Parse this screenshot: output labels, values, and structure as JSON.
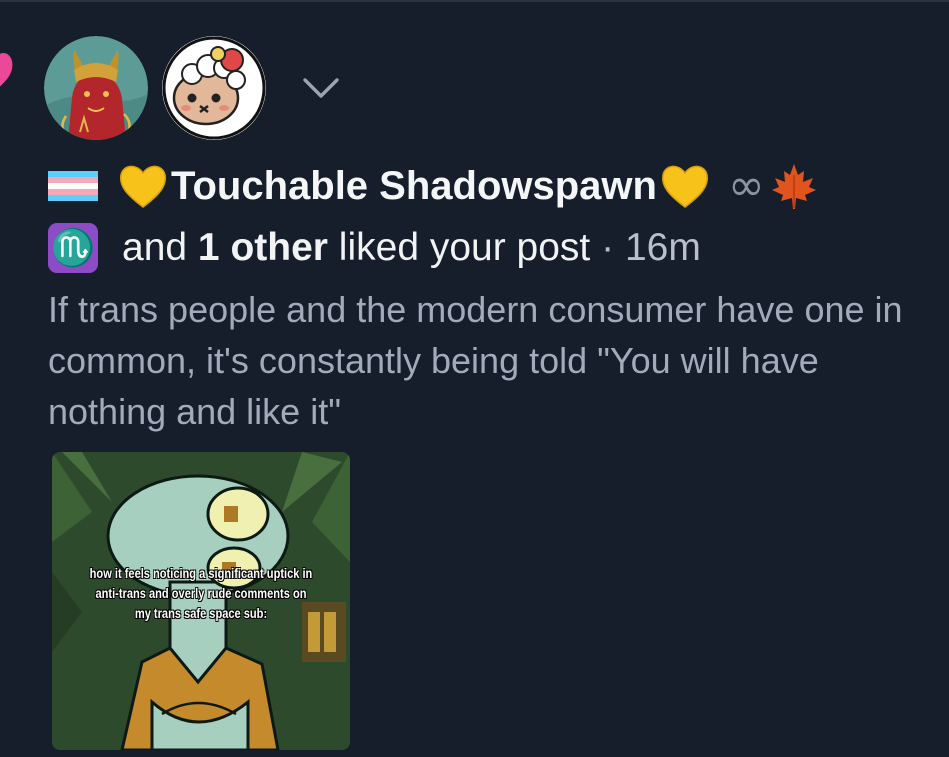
{
  "notification": {
    "type": "like",
    "icons": {
      "like": "heart-icon",
      "expand": "chevron-down-icon",
      "flag": "transgender-flag-icon",
      "name_decorations": [
        "yellow-heart-icon",
        "yellow-heart-icon",
        "infinity-icon",
        "maple-leaf-icon"
      ],
      "zodiac": "scorpio-icon"
    },
    "avatars": [
      {
        "name": "red-devil-avatar"
      },
      {
        "name": "cartoon-sheep-avatar"
      }
    ],
    "actor": {
      "display_name": "Touchable Shadowspawn",
      "infinity": "∞",
      "zodiac_glyph": "♏"
    },
    "activity": {
      "conjunction": "and",
      "others": "1 other",
      "action": "liked your post",
      "separator": "·",
      "time": "16m"
    },
    "post": {
      "text": "If trans people and the modern consumer have one in common, it's constantly being told \"You will have nothing and like it\"",
      "image_caption": [
        "how it feels noticing a significant uptick in",
        "anti-trans and overly rude comments on",
        "my trans safe space sub:"
      ]
    }
  },
  "colors": {
    "background": "#161e2b",
    "like_heart": "#ec4899",
    "preview_text": "#a2abba",
    "zodiac_badge": "#8e4bc6"
  }
}
